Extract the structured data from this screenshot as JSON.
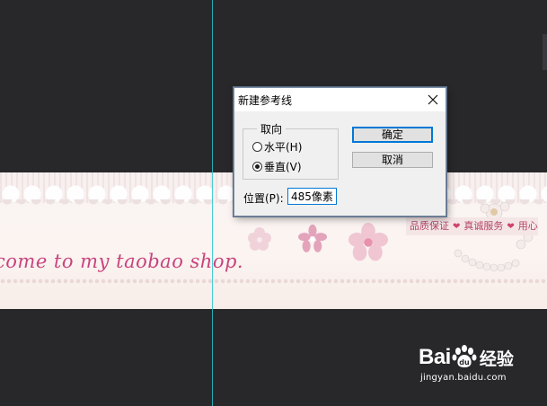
{
  "banner": {
    "welcome_text": "come to my taobao shop.",
    "promise_items": [
      "品质保证",
      "真诚服务",
      "用心"
    ]
  },
  "dialog": {
    "title": "新建参考线",
    "orientation_group": {
      "legend": "取向",
      "options": [
        {
          "label": "水平(H)",
          "checked": false
        },
        {
          "label": "垂直(V)",
          "checked": true
        }
      ]
    },
    "position_label": "位置(P):",
    "position_value": "485像素",
    "ok_label": "确定",
    "cancel_label": "取消"
  },
  "watermark": {
    "brand": "Bai",
    "brand_suffix": "经验",
    "url": "jingyan.baidu.com"
  },
  "colors": {
    "workspace": "#28272a",
    "guide": "#27c6cf",
    "banner_text": "#c8437e",
    "focus_blue": "#0078d7"
  },
  "icons": {
    "close": "close-icon",
    "paw": "paw-icon",
    "heart": "heart-icon"
  }
}
